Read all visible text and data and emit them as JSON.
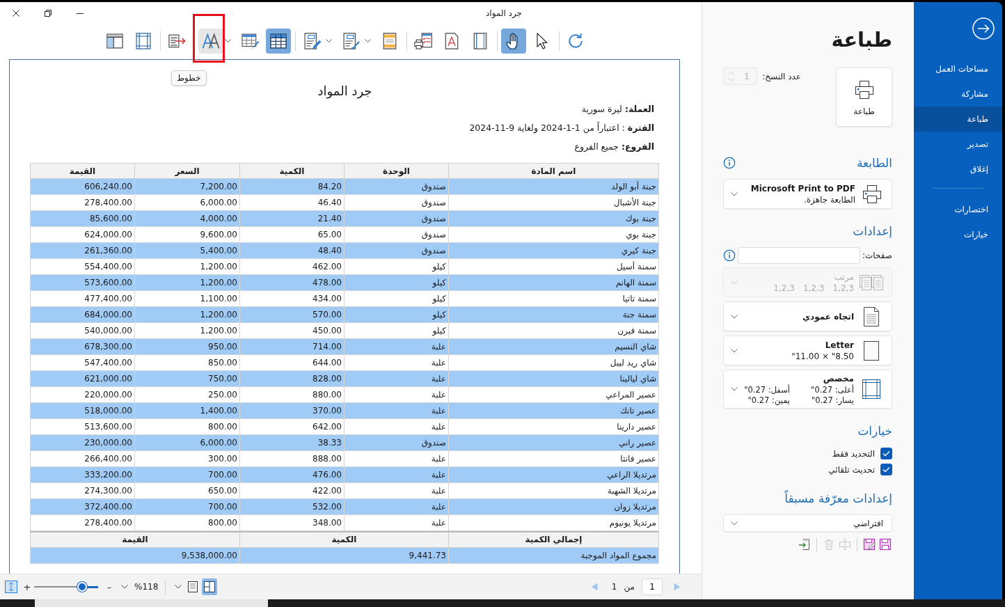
{
  "window": {
    "title": "جرد المواد"
  },
  "toolbar": {
    "hover_frame": true,
    "groups": [
      [
        {
          "selected": false,
          "hovered": false,
          "has_menu": false
        },
        {
          "selected": false,
          "hovered": false,
          "has_menu": false
        }
      ],
      [
        {
          "selected": false,
          "hovered": false,
          "has_menu": false
        },
        {
          "selected": false,
          "hovered": true,
          "has_menu": true,
          "tooltip": "خطوط"
        },
        {
          "selected": false,
          "hovered": false,
          "has_menu": false
        },
        {
          "selected": true,
          "hovered": false,
          "has_menu": false
        }
      ],
      [
        {
          "selected": false,
          "hovered": false,
          "has_menu": true
        },
        {
          "selected": false,
          "hovered": false,
          "has_menu": true
        },
        {
          "selected": false,
          "hovered": false,
          "has_menu": false
        }
      ],
      [
        {
          "selected": false,
          "hovered": false,
          "has_menu": false
        },
        {
          "selected": false,
          "hovered": false,
          "has_menu": false
        },
        {
          "selected": false,
          "hovered": false,
          "has_menu": false
        }
      ],
      [
        {
          "selected": true,
          "hovered": false,
          "has_menu": false
        },
        {
          "selected": false,
          "hovered": false,
          "has_menu": false
        }
      ],
      [
        {
          "selected": false,
          "hovered": false,
          "has_menu": false
        }
      ]
    ]
  },
  "report": {
    "title": "جرد المواد",
    "info_lines": [
      "**العملة:** ليرة سورية",
      "**الفترة** : اعتباراً من 1-1-2024 ولغاية 9-11-2024",
      "**الفروع:** جميع الفروع"
    ],
    "table": {
      "columns": [
        "اسم المادة",
        "الوحدة",
        "الكمية",
        "السعر",
        "القيمة"
      ],
      "rows": [
        [
          "جبنة أبو الولد",
          "صندوق",
          "84.20",
          "7,200.00",
          "606,240.00"
        ],
        [
          "جبنة الأشبال",
          "صندوق",
          "46.40",
          "6,000.00",
          "278,400.00"
        ],
        [
          "جبنة بوك",
          "صندوق",
          "21.40",
          "4,000.00",
          "85,600.00"
        ],
        [
          "جبنة بوي",
          "صندوق",
          "65.00",
          "9,600.00",
          "624,000.00"
        ],
        [
          "جبنة كيري",
          "صندوق",
          "48.40",
          "5,400.00",
          "261,360.00"
        ],
        [
          "سمنة أسيل",
          "كيلو",
          "462.00",
          "1,200.00",
          "554,400.00"
        ],
        [
          "سمنة الهانم",
          "كيلو",
          "478.00",
          "1,200.00",
          "573,600.00"
        ],
        [
          "سمنة تاتيا",
          "كيلو",
          "434.00",
          "1,100.00",
          "477,400.00"
        ],
        [
          "سمنة جنة",
          "كيلو",
          "570.00",
          "1,200.00",
          "684,000.00"
        ],
        [
          "سمنة فيرن",
          "كيلو",
          "450.00",
          "1,200.00",
          "540,000.00"
        ],
        [
          "شاي النسيم",
          "علبة",
          "714.00",
          "950.00",
          "678,300.00"
        ],
        [
          "شاي ريد ليبل",
          "علبة",
          "644.00",
          "850.00",
          "547,400.00"
        ],
        [
          "شاي ليالينا",
          "علبة",
          "828.00",
          "750.00",
          "621,000.00"
        ],
        [
          "عصير المراعي",
          "علبة",
          "880.00",
          "250.00",
          "220,000.00"
        ],
        [
          "عصير تانك",
          "علبة",
          "370.00",
          "1,400.00",
          "518,000.00"
        ],
        [
          "عصير دارينا",
          "علبة",
          "642.00",
          "800.00",
          "513,600.00"
        ],
        [
          "عصير راني",
          "صندوق",
          "38.33",
          "6,000.00",
          "230,000.00"
        ],
        [
          "عصير فانتا",
          "علبة",
          "888.00",
          "300.00",
          "266,400.00"
        ],
        [
          "مرتديلا الراعي",
          "علبة",
          "476.00",
          "700.00",
          "333,200.00"
        ],
        [
          "مرتديلا الشهبة",
          "علبة",
          "422.00",
          "650.00",
          "274,300.00"
        ],
        [
          "مرتديلا زوان",
          "علبة",
          "532.00",
          "700.00",
          "372,400.00"
        ],
        [
          "مرتديلا يونيوم",
          "علبة",
          "348.00",
          "800.00",
          "278,400.00"
        ]
      ]
    },
    "totals": {
      "columns": [
        "إجمالي الكمية",
        "الكمية",
        "القيمة"
      ],
      "rows": [
        [
          "مجموع المواد الموجبة",
          "9,441.73",
          "9,538,000.00"
        ]
      ]
    }
  },
  "status_bar": {
    "zoom": {
      "zoom_in": "+",
      "zoom_out": "–",
      "level": 0.25,
      "reading": "%118"
    },
    "view_buttons": [
      {
        "selected": false
      },
      {
        "selected": true
      }
    ],
    "pager": {
      "total": "1",
      "of_label": "من",
      "current": "1"
    }
  },
  "print_panel": {
    "title": "طباعة",
    "print_button": "طباعة",
    "copies": {
      "label": "عدد النسخ:",
      "value": "1",
      "disabled": true
    },
    "printer": {
      "heading": "الطابعة",
      "name": "Microsoft Print to PDF",
      "status": "الطابعة جاهزة."
    },
    "settings": {
      "heading": "إعدادات",
      "pages_label": "صفحات:",
      "dropdowns": [
        {
          "kind": "collate",
          "title": "مرتب",
          "details": [
            "1,2,3",
            "1,2,3",
            "1,2,3"
          ],
          "disabled": true
        },
        {
          "kind": "orientation",
          "title": "اتجاه عمودي",
          "disabled": false
        },
        {
          "kind": "paper",
          "title": "Letter",
          "details": [
            "8.50\" × 11.00\""
          ],
          "disabled": false
        },
        {
          "kind": "margins",
          "title": "مخصص",
          "details": [
            "أعلى: 0.27\"",
            "يسار: 0.27\"",
            "أسفل: 0.27\"",
            "يمين: 0.27\""
          ],
          "disabled": false
        }
      ]
    },
    "options": {
      "heading": "خيارات",
      "checkboxes": [
        {
          "label": "التحديد فقط",
          "checked": true
        },
        {
          "label": "تحديث تلقائي",
          "checked": true
        }
      ]
    },
    "presets": {
      "heading": "إعدادات معرّفة مسبقاً",
      "value": "افتراضي",
      "action_groups": [
        [
          {
            "disabled": false
          },
          {
            "disabled": false
          }
        ],
        [
          {
            "disabled": true
          },
          {
            "disabled": true
          }
        ],
        [
          {
            "disabled": false
          }
        ]
      ]
    }
  },
  "sidebar": {
    "groups": [
      {
        "items": [
          {
            "label": "مساحات العمل",
            "selected": false
          },
          {
            "label": "مشاركة",
            "selected": false
          },
          {
            "label": "طباعة",
            "selected": true
          },
          {
            "label": "تصدير",
            "selected": false
          },
          {
            "label": "إغلاق",
            "selected": false
          }
        ]
      },
      {
        "items": [
          {
            "label": "اختصارات",
            "selected": false
          },
          {
            "label": "خيارات",
            "selected": false
          }
        ]
      }
    ]
  }
}
